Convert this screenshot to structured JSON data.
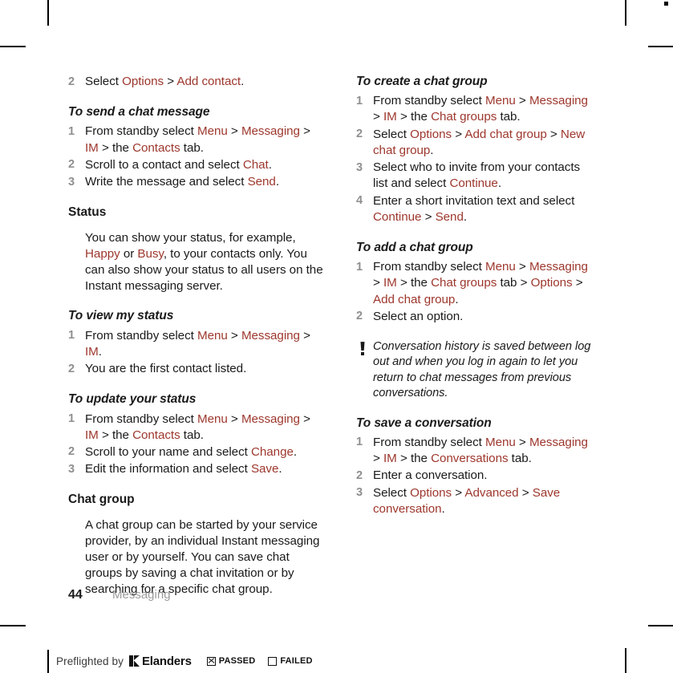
{
  "document": {
    "page_number": "44",
    "chapter": "Messaging"
  },
  "left_column": {
    "blocks": [
      {
        "type": "list_item_continued",
        "number": "2",
        "segments": [
          {
            "t": "Select ",
            "link": false
          },
          {
            "t": "Options",
            "link": true
          },
          {
            "t": " > ",
            "link": false
          },
          {
            "t": "Add contact",
            "link": true
          },
          {
            "t": ".",
            "link": false
          }
        ]
      },
      {
        "type": "heading_italic",
        "text": "To send a chat message"
      },
      {
        "type": "list",
        "items": [
          {
            "number": "1",
            "segments": [
              {
                "t": "From standby select ",
                "link": false
              },
              {
                "t": "Menu",
                "link": true
              },
              {
                "t": " > ",
                "link": false
              },
              {
                "t": "Messaging",
                "link": true
              },
              {
                "t": " > ",
                "link": false
              },
              {
                "t": "IM",
                "link": true
              },
              {
                "t": " > the ",
                "link": false
              },
              {
                "t": "Contacts",
                "link": true
              },
              {
                "t": " tab.",
                "link": false
              }
            ]
          },
          {
            "number": "2",
            "segments": [
              {
                "t": "Scroll to a contact and select ",
                "link": false
              },
              {
                "t": "Chat",
                "link": true
              },
              {
                "t": ".",
                "link": false
              }
            ]
          },
          {
            "number": "3",
            "segments": [
              {
                "t": "Write the message and select ",
                "link": false
              },
              {
                "t": "Send",
                "link": true
              },
              {
                "t": ".",
                "link": false
              }
            ]
          }
        ]
      },
      {
        "type": "heading_bold",
        "text": "Status"
      },
      {
        "type": "paragraph",
        "segments": [
          {
            "t": "You can show your status, for example, ",
            "link": false
          },
          {
            "t": "Happy",
            "link": true
          },
          {
            "t": " or ",
            "link": false
          },
          {
            "t": "Busy",
            "link": true
          },
          {
            "t": ", to your contacts only. You can also show your status to all users on the Instant messaging server.",
            "link": false
          }
        ]
      },
      {
        "type": "heading_italic",
        "text": "To view my status"
      },
      {
        "type": "list",
        "items": [
          {
            "number": "1",
            "segments": [
              {
                "t": "From standby select ",
                "link": false
              },
              {
                "t": "Menu",
                "link": true
              },
              {
                "t": " > ",
                "link": false
              },
              {
                "t": "Messaging",
                "link": true
              },
              {
                "t": " > ",
                "link": false
              },
              {
                "t": "IM",
                "link": true
              },
              {
                "t": ".",
                "link": false
              }
            ]
          },
          {
            "number": "2",
            "segments": [
              {
                "t": "You are the first contact listed.",
                "link": false
              }
            ]
          }
        ]
      },
      {
        "type": "heading_italic",
        "text": "To update your status"
      },
      {
        "type": "list",
        "items": [
          {
            "number": "1",
            "segments": [
              {
                "t": "From standby select ",
                "link": false
              },
              {
                "t": "Menu",
                "link": true
              },
              {
                "t": " > ",
                "link": false
              },
              {
                "t": "Messaging",
                "link": true
              },
              {
                "t": " > ",
                "link": false
              },
              {
                "t": "IM",
                "link": true
              },
              {
                "t": " > the ",
                "link": false
              },
              {
                "t": "Contacts",
                "link": true
              },
              {
                "t": " tab.",
                "link": false
              }
            ]
          },
          {
            "number": "2",
            "segments": [
              {
                "t": "Scroll to your name and select ",
                "link": false
              },
              {
                "t": "Change",
                "link": true
              },
              {
                "t": ".",
                "link": false
              }
            ]
          },
          {
            "number": "3",
            "segments": [
              {
                "t": "Edit the information and select ",
                "link": false
              },
              {
                "t": "Save",
                "link": true
              },
              {
                "t": ".",
                "link": false
              }
            ]
          }
        ]
      },
      {
        "type": "heading_bold",
        "text": "Chat group"
      },
      {
        "type": "paragraph",
        "segments": [
          {
            "t": "A chat group can be started by your service provider, by an individual Instant messaging user or by yourself. You can save chat groups by saving a chat invitation or by searching for a specific chat group.",
            "link": false
          }
        ]
      }
    ]
  },
  "right_column": {
    "blocks": [
      {
        "type": "heading_italic",
        "text": "To create a chat group"
      },
      {
        "type": "list",
        "items": [
          {
            "number": "1",
            "segments": [
              {
                "t": "From standby select ",
                "link": false
              },
              {
                "t": "Menu",
                "link": true
              },
              {
                "t": " > ",
                "link": false
              },
              {
                "t": "Messaging",
                "link": true
              },
              {
                "t": " > ",
                "link": false
              },
              {
                "t": "IM",
                "link": true
              },
              {
                "t": " > the ",
                "link": false
              },
              {
                "t": "Chat groups",
                "link": true
              },
              {
                "t": " tab.",
                "link": false
              }
            ]
          },
          {
            "number": "2",
            "segments": [
              {
                "t": "Select ",
                "link": false
              },
              {
                "t": "Options",
                "link": true
              },
              {
                "t": " > ",
                "link": false
              },
              {
                "t": "Add chat group",
                "link": true
              },
              {
                "t": " > ",
                "link": false
              },
              {
                "t": "New chat group",
                "link": true
              },
              {
                "t": ".",
                "link": false
              }
            ]
          },
          {
            "number": "3",
            "segments": [
              {
                "t": "Select who to invite from your contacts list and select ",
                "link": false
              },
              {
                "t": "Continue",
                "link": true
              },
              {
                "t": ".",
                "link": false
              }
            ]
          },
          {
            "number": "4",
            "segments": [
              {
                "t": "Enter a short invitation text and select ",
                "link": false
              },
              {
                "t": "Continue",
                "link": true
              },
              {
                "t": " > ",
                "link": false
              },
              {
                "t": "Send",
                "link": true
              },
              {
                "t": ".",
                "link": false
              }
            ]
          }
        ]
      },
      {
        "type": "heading_italic",
        "text": "To add a chat group"
      },
      {
        "type": "list",
        "items": [
          {
            "number": "1",
            "segments": [
              {
                "t": "From standby select ",
                "link": false
              },
              {
                "t": "Menu",
                "link": true
              },
              {
                "t": " > ",
                "link": false
              },
              {
                "t": "Messaging",
                "link": true
              },
              {
                "t": " > ",
                "link": false
              },
              {
                "t": "IM",
                "link": true
              },
              {
                "t": " > the ",
                "link": false
              },
              {
                "t": "Chat groups",
                "link": true
              },
              {
                "t": " tab > ",
                "link": false
              },
              {
                "t": "Options",
                "link": true
              },
              {
                "t": " > ",
                "link": false
              },
              {
                "t": "Add chat group",
                "link": true
              },
              {
                "t": ".",
                "link": false
              }
            ]
          },
          {
            "number": "2",
            "segments": [
              {
                "t": "Select an option.",
                "link": false
              }
            ]
          }
        ]
      },
      {
        "type": "note",
        "icon": "exclamation-note-icon",
        "text": "Conversation history is saved between log out and when you log in again to let you return to chat messages from previous conversations."
      },
      {
        "type": "heading_italic",
        "text": "To save a conversation"
      },
      {
        "type": "list",
        "items": [
          {
            "number": "1",
            "segments": [
              {
                "t": "From standby select ",
                "link": false
              },
              {
                "t": "Menu",
                "link": true
              },
              {
                "t": " > ",
                "link": false
              },
              {
                "t": "Messaging",
                "link": true
              },
              {
                "t": " > ",
                "link": false
              },
              {
                "t": "IM",
                "link": true
              },
              {
                "t": " > the ",
                "link": false
              },
              {
                "t": "Conversations",
                "link": true
              },
              {
                "t": " tab.",
                "link": false
              }
            ]
          },
          {
            "number": "2",
            "segments": [
              {
                "t": "Enter a conversation.",
                "link": false
              }
            ]
          },
          {
            "number": "3",
            "segments": [
              {
                "t": "Select ",
                "link": false
              },
              {
                "t": "Options",
                "link": true
              },
              {
                "t": " > ",
                "link": false
              },
              {
                "t": "Advanced",
                "link": true
              },
              {
                "t": " > ",
                "link": false
              },
              {
                "t": "Save conversation",
                "link": true
              },
              {
                "t": ".",
                "link": false
              }
            ]
          }
        ]
      }
    ]
  },
  "preflight_bar": {
    "label": "Preflighted by",
    "brand": "Elanders",
    "passed_label": "PASSED",
    "failed_label": "FAILED",
    "passed_checked": true,
    "failed_checked": false
  },
  "colors": {
    "link": "#9d372d",
    "step_number": "#8f8f8f",
    "body_text": "#1a1a1a",
    "chapter_text": "#9b9b9b",
    "background": "#ffffff"
  }
}
